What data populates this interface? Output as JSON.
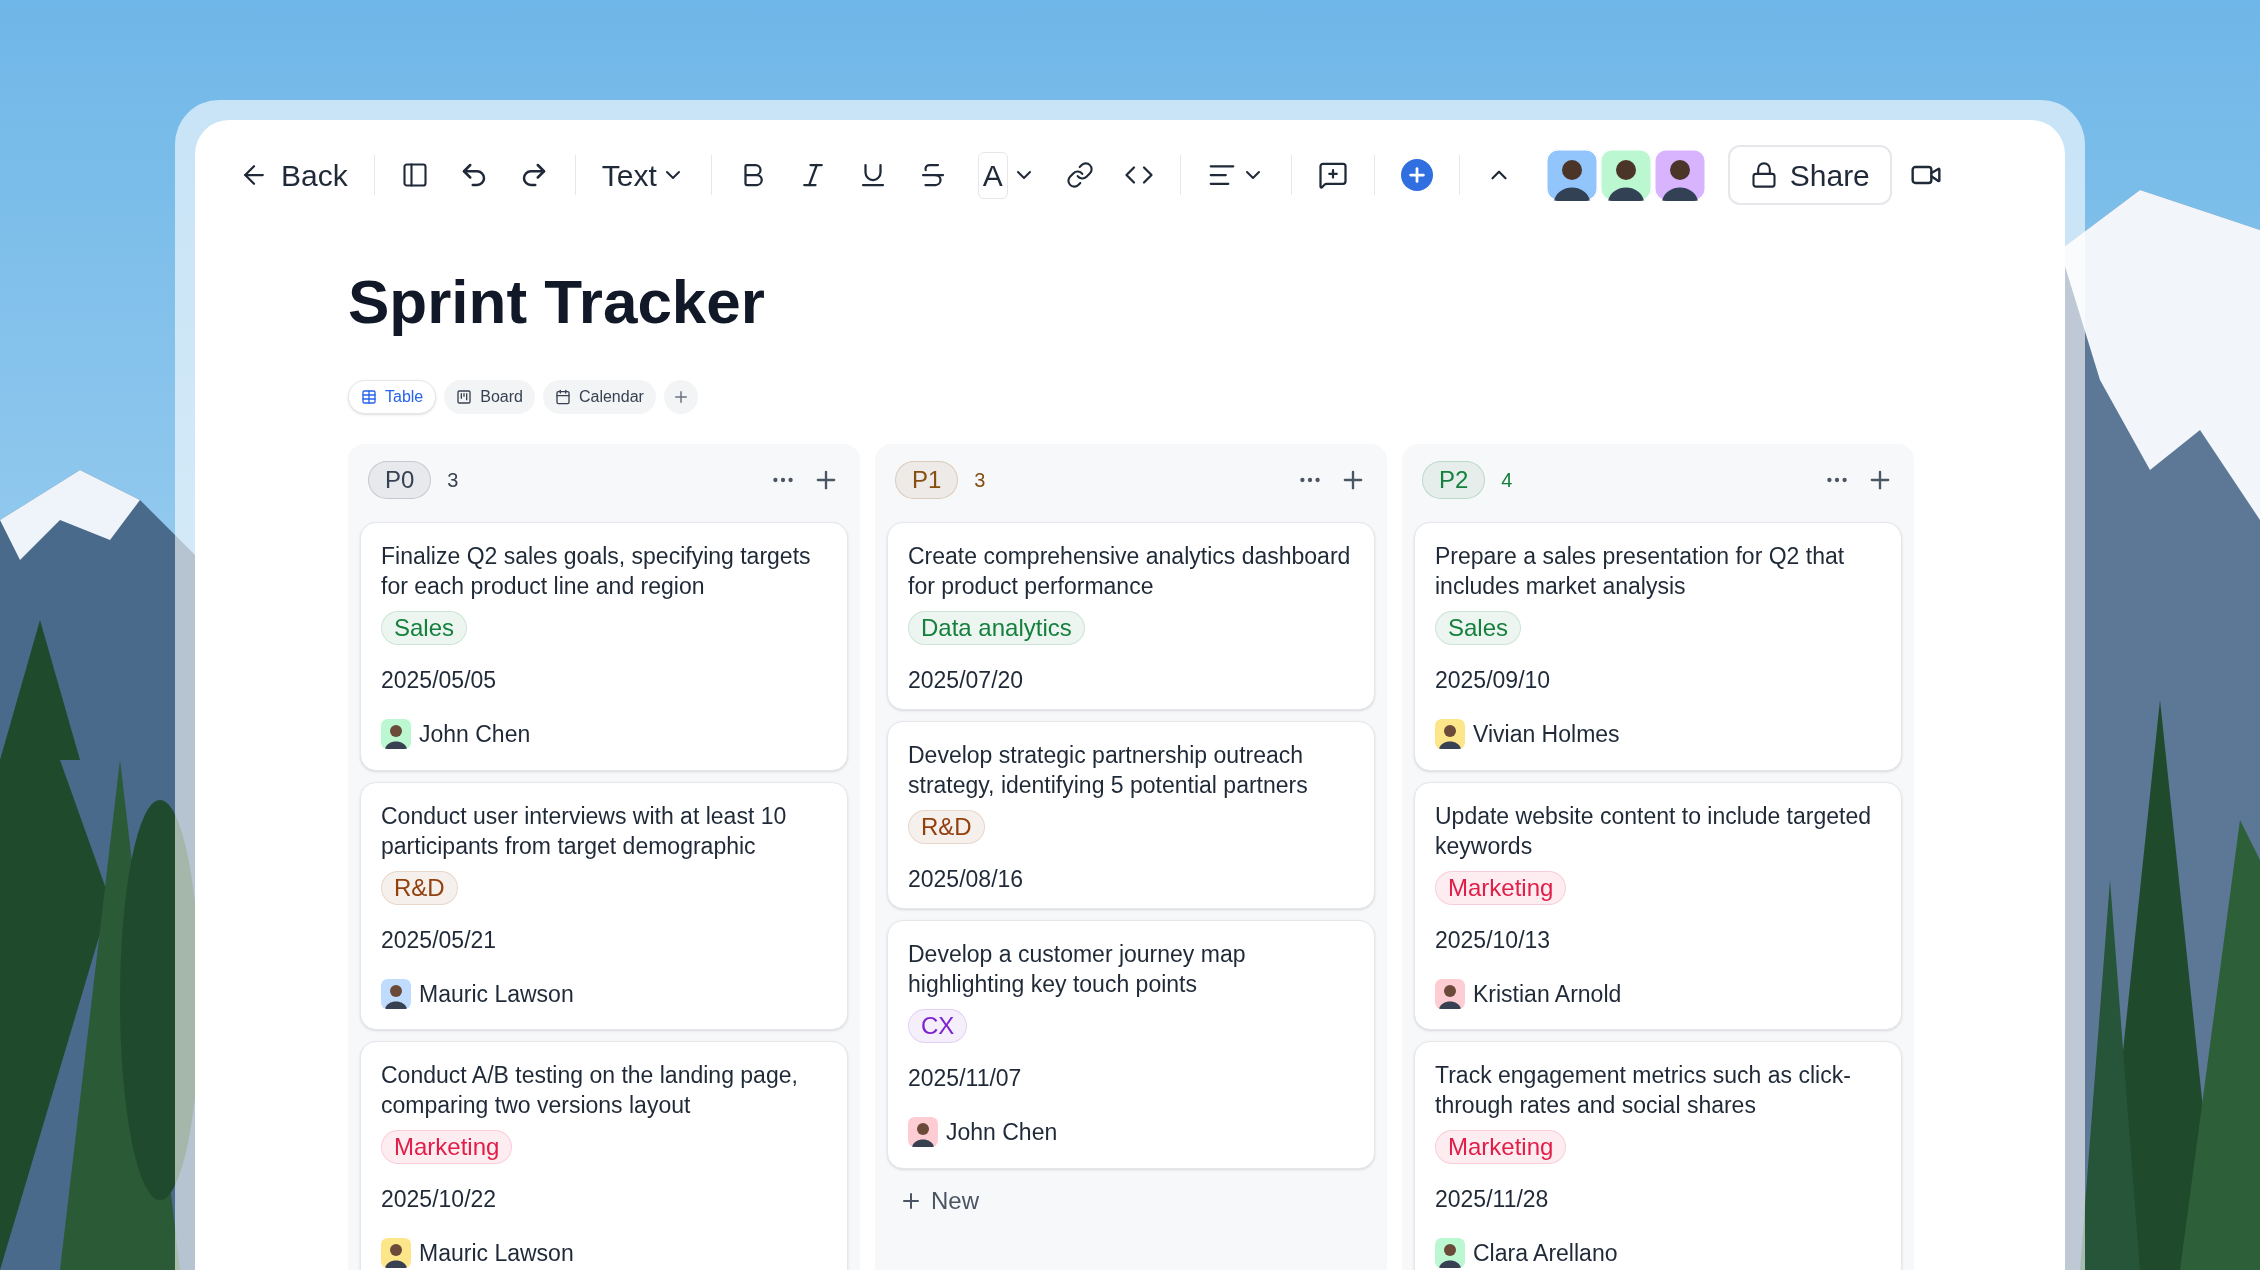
{
  "toolbar": {
    "back": "Back",
    "text_style": "Text",
    "font_color": "A",
    "share": "Share"
  },
  "title": "Sprint Tracker",
  "views": [
    {
      "label": "Table",
      "selected": true
    },
    {
      "label": "Board",
      "selected": false
    },
    {
      "label": "Calendar",
      "selected": false
    }
  ],
  "columns": [
    {
      "label": "P0",
      "count": "3",
      "color": "#374151",
      "cards": [
        {
          "title": "Finalize Q2 sales goals, specifying targets for each product line and region",
          "tag": {
            "label": "Sales",
            "color": "#15803d"
          },
          "date": "2025/05/05",
          "assignee": "John Chen"
        },
        {
          "title": "Conduct user interviews with at least 10 participants from target demographic",
          "tag": {
            "label": "R&D",
            "color": "#92400e"
          },
          "date": "2025/05/21",
          "assignee": "Mauric Lawson"
        },
        {
          "title": "Conduct A/B testing on the landing page, comparing two versions layout",
          "tag": {
            "label": "Marketing",
            "color": "#e11d48"
          },
          "date": "2025/10/22",
          "assignee": "Mauric Lawson"
        }
      ]
    },
    {
      "label": "P1",
      "count": "3",
      "color": "#854d0e",
      "new_label": "New",
      "cards": [
        {
          "title": "Create comprehensive analytics dashboard for product performance",
          "tag": {
            "label": "Data analytics",
            "color": "#15803d"
          },
          "date": "2025/07/20"
        },
        {
          "title": "Develop strategic partnership outreach strategy, identifying 5 potential partners",
          "tag": {
            "label": "R&D",
            "color": "#92400e"
          },
          "date": "2025/08/16"
        },
        {
          "title": "Develop a customer journey map highlighting key touch points",
          "tag": {
            "label": "CX",
            "color": "#7e22ce"
          },
          "date": "2025/11/07",
          "assignee": "John Chen"
        }
      ]
    },
    {
      "label": "P2",
      "count": "4",
      "color": "#15803d",
      "cards": [
        {
          "title": "Prepare a sales presentation for Q2 that includes market analysis",
          "tag": {
            "label": "Sales",
            "color": "#15803d"
          },
          "date": "2025/09/10",
          "assignee": "Vivian Holmes"
        },
        {
          "title": "Update website content to include targeted keywords",
          "tag": {
            "label": "Marketing",
            "color": "#e11d48"
          },
          "date": "2025/10/13",
          "assignee": "Kristian Arnold"
        },
        {
          "title": "Track engagement metrics such as click-through rates and social shares",
          "tag": {
            "label": "Marketing",
            "color": "#e11d48"
          },
          "date": "2025/11/28",
          "assignee": "Clara Arellano"
        }
      ]
    }
  ]
}
